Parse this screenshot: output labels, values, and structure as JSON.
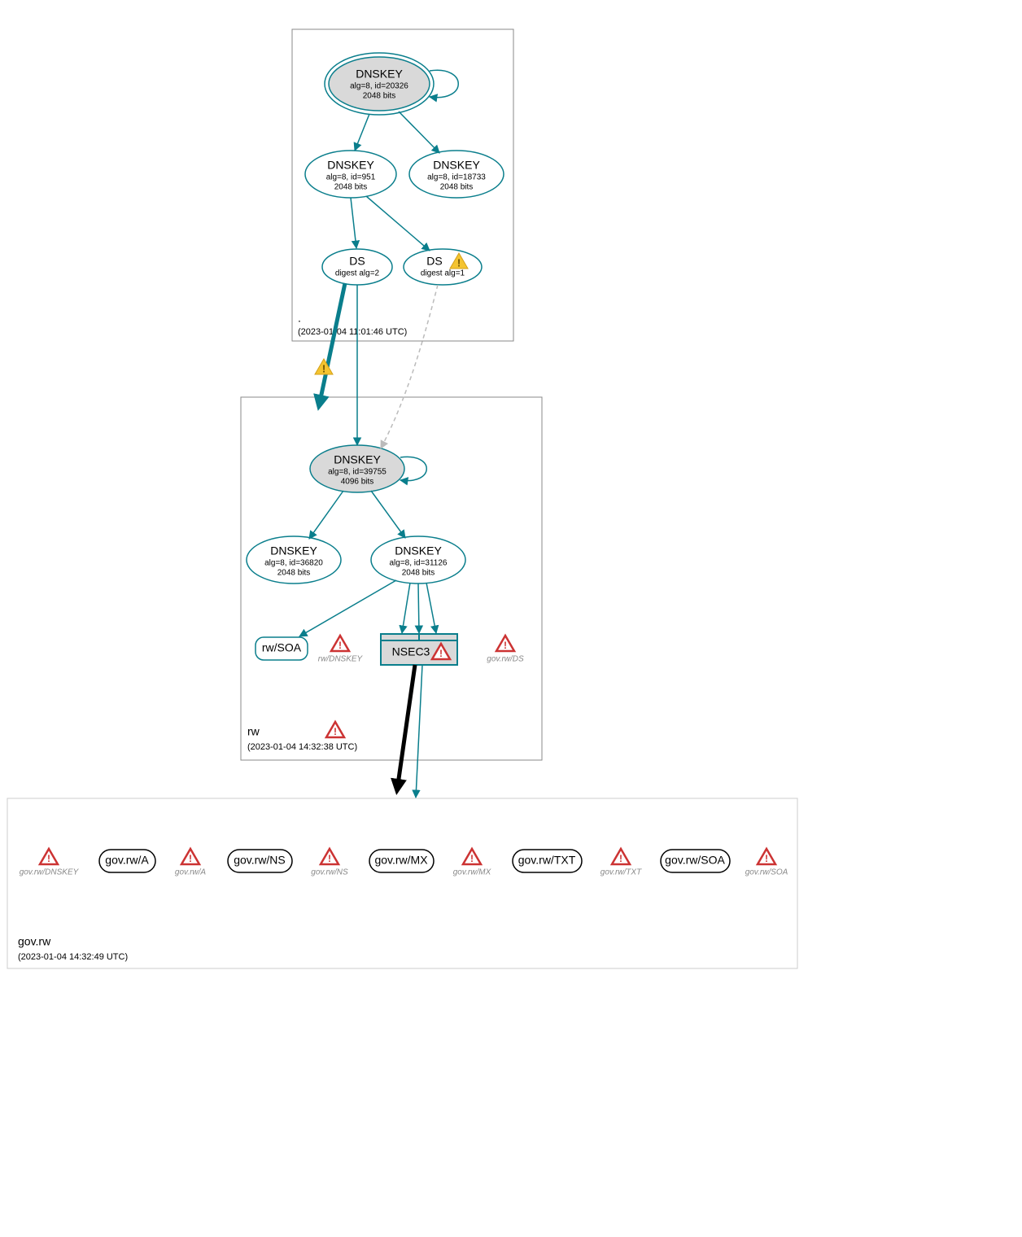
{
  "colors": {
    "teal": "#0a7e8c",
    "shade": "#d9d9d9",
    "border_gray": "#888888",
    "border_light": "#cccccc",
    "dashed_gray": "#bbbbbb",
    "error_red": "#cc3333",
    "warning_yellow": "#f4c430"
  },
  "zones": [
    {
      "name": ".",
      "timestamp": "(2023-01-04 11:01:46 UTC)",
      "nodes": [
        {
          "id": "root-ksk",
          "type": "dnskey",
          "shaded": true,
          "double_ring": true,
          "title": "DNSKEY",
          "sub1": "alg=8, id=20326",
          "sub2": "2048 bits",
          "self_loop": true
        },
        {
          "id": "root-dnskey-951",
          "type": "dnskey",
          "title": "DNSKEY",
          "sub1": "alg=8, id=951",
          "sub2": "2048 bits"
        },
        {
          "id": "root-dnskey-18733",
          "type": "dnskey",
          "title": "DNSKEY",
          "sub1": "alg=8, id=18733",
          "sub2": "2048 bits"
        },
        {
          "id": "root-ds-2",
          "type": "ds",
          "title": "DS",
          "sub1": "digest alg=2"
        },
        {
          "id": "root-ds-1",
          "type": "ds",
          "title": "DS",
          "sub1": "digest alg=1",
          "warning": true
        }
      ],
      "edges": [
        {
          "from": "root-ksk",
          "to": "root-dnskey-951"
        },
        {
          "from": "root-ksk",
          "to": "root-dnskey-18733"
        },
        {
          "from": "root-dnskey-951",
          "to": "root-ds-2"
        },
        {
          "from": "root-dnskey-951",
          "to": "root-ds-1"
        }
      ]
    },
    {
      "name": "rw",
      "timestamp": "(2023-01-04 14:32:38 UTC)",
      "zone_error": true,
      "nodes": [
        {
          "id": "rw-ksk",
          "type": "dnskey",
          "shaded": true,
          "title": "DNSKEY",
          "sub1": "alg=8, id=39755",
          "sub2": "4096 bits",
          "self_loop": true
        },
        {
          "id": "rw-dnskey-36820",
          "type": "dnskey",
          "title": "DNSKEY",
          "sub1": "alg=8, id=36820",
          "sub2": "2048 bits"
        },
        {
          "id": "rw-dnskey-31126",
          "type": "dnskey",
          "title": "DNSKEY",
          "sub1": "alg=8, id=31126",
          "sub2": "2048 bits"
        },
        {
          "id": "rw-soa",
          "type": "rr-rounded",
          "title": "rw/SOA"
        },
        {
          "id": "rw-dnskey-err",
          "type": "error-label",
          "title": "rw/DNSKEY"
        },
        {
          "id": "rw-nsec3",
          "type": "nsec3",
          "title": "NSEC3",
          "error": true
        },
        {
          "id": "gov-rw-ds-err",
          "type": "error-label",
          "title": "gov.rw/DS"
        }
      ],
      "edges": [
        {
          "from": "rw-ksk",
          "to": "rw-dnskey-36820"
        },
        {
          "from": "rw-ksk",
          "to": "rw-dnskey-31126"
        },
        {
          "from": "rw-dnskey-31126",
          "to": "rw-soa"
        },
        {
          "from": "rw-dnskey-31126",
          "to": "rw-nsec3",
          "count": 3
        }
      ]
    },
    {
      "name": "gov.rw",
      "timestamp": "(2023-01-04 14:32:49 UTC)",
      "items": [
        {
          "type": "error-label",
          "title": "gov.rw/DNSKEY"
        },
        {
          "type": "rr-black",
          "title": "gov.rw/A"
        },
        {
          "type": "error-label",
          "title": "gov.rw/A"
        },
        {
          "type": "rr-black",
          "title": "gov.rw/NS"
        },
        {
          "type": "error-label",
          "title": "gov.rw/NS"
        },
        {
          "type": "rr-black",
          "title": "gov.rw/MX"
        },
        {
          "type": "error-label",
          "title": "gov.rw/MX"
        },
        {
          "type": "rr-black",
          "title": "gov.rw/TXT"
        },
        {
          "type": "error-label",
          "title": "gov.rw/TXT"
        },
        {
          "type": "rr-black",
          "title": "gov.rw/SOA"
        },
        {
          "type": "error-label",
          "title": "gov.rw/SOA"
        }
      ]
    }
  ],
  "cross_zone_edges": [
    {
      "from": "root-ds-2",
      "to": "rw-ksk",
      "style": "heavy",
      "warning": true
    },
    {
      "from": "root-ds-2",
      "to": "rw-ksk",
      "style": "normal"
    },
    {
      "from": "root-ds-1",
      "to": "rw-ksk",
      "style": "dashed"
    },
    {
      "from": "rw-nsec3",
      "to": "zone-gov.rw",
      "style": "black-heavy"
    },
    {
      "from": "rw-nsec3",
      "to": "zone-gov.rw",
      "style": "normal"
    }
  ]
}
